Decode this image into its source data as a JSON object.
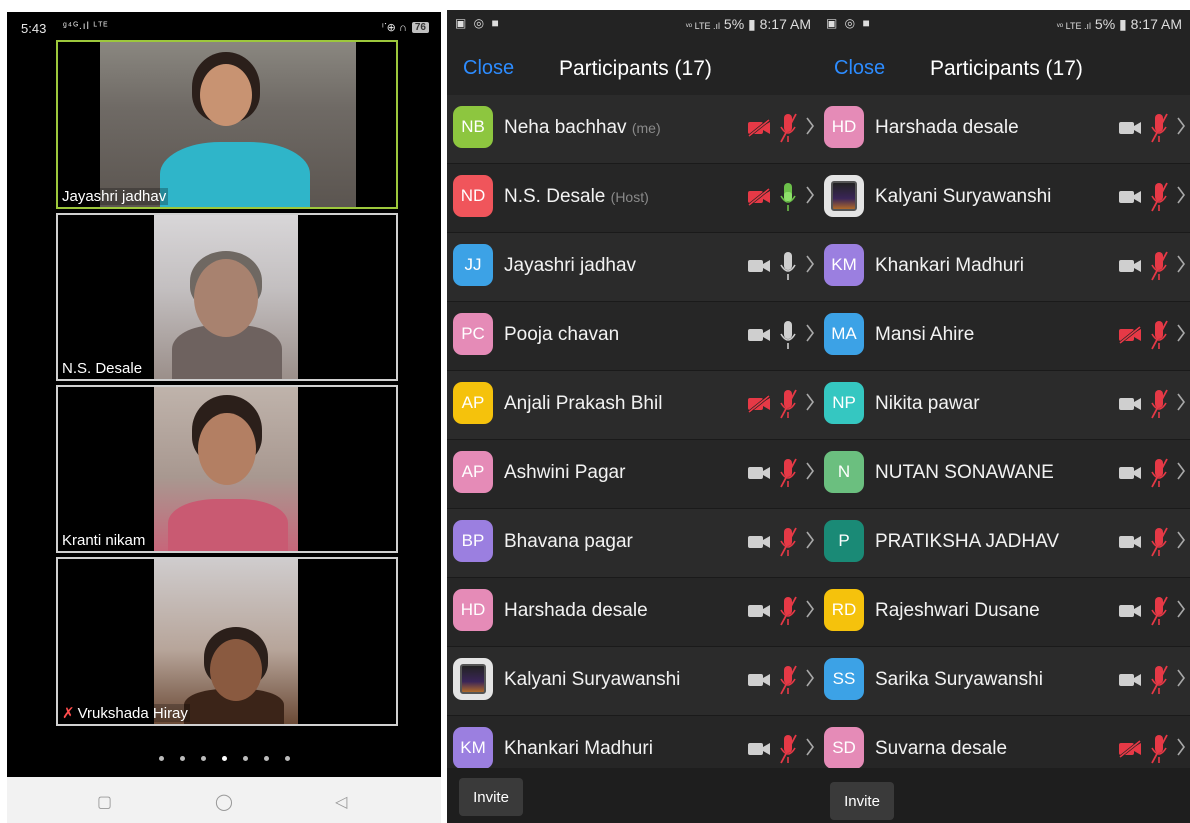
{
  "left_phone": {
    "status": {
      "time": "5:43",
      "signal": "ᵍ⁴ᴳ.ıl ᴸᵀᴱ",
      "icons": "ⁱᐝ⊕ ∩",
      "battery": "76"
    },
    "tiles": [
      {
        "name": "Jayashri jadhav",
        "muted": false
      },
      {
        "name": "N.S. Desale",
        "muted": false
      },
      {
        "name": "Kranti nikam",
        "muted": false
      },
      {
        "name": "Vrukshada Hiray",
        "muted": true
      }
    ],
    "page_dots": 7,
    "active_dot": 3,
    "nav": {
      "recents": "▢",
      "home": "◯",
      "back": "◁"
    }
  },
  "panel_left": {
    "status": {
      "left_icons": "▣ ◎ ■",
      "right": "5% ▮ 8:17 AM",
      "signal": "ᵛᵒ LTE .ıl"
    },
    "close_label": "Close",
    "title": "Participants (17)",
    "invite_label": "Invite",
    "participants": [
      {
        "initials": "NB",
        "name": "Neha bachhav",
        "tag": "(me)",
        "color": "#8dc63f",
        "video_off": true,
        "mic": "muted"
      },
      {
        "initials": "ND",
        "name": "N.S. Desale",
        "tag": "(Host)",
        "color": "#f0555b",
        "video_off": true,
        "mic": "active"
      },
      {
        "initials": "JJ",
        "name": "Jayashri jadhav",
        "tag": "",
        "color": "#3ca2e6",
        "video_off": false,
        "mic": "on"
      },
      {
        "initials": "PC",
        "name": "Pooja chavan",
        "tag": "",
        "color": "#e58bb7",
        "video_off": false,
        "mic": "on"
      },
      {
        "initials": "AP",
        "name": "Anjali Prakash Bhil",
        "tag": "",
        "color": "#f5c20c",
        "video_off": true,
        "mic": "muted"
      },
      {
        "initials": "AP",
        "name": "Ashwini Pagar",
        "tag": "",
        "color": "#e58bb7",
        "video_off": false,
        "mic": "muted"
      },
      {
        "initials": "BP",
        "name": "Bhavana pagar",
        "tag": "",
        "color": "#9b7fe0",
        "video_off": false,
        "mic": "muted"
      },
      {
        "initials": "HD",
        "name": "Harshada desale",
        "tag": "",
        "color": "#e58bb7",
        "video_off": false,
        "mic": "muted"
      },
      {
        "initials": "",
        "name": "Kalyani Suryawanshi",
        "tag": "",
        "color": "mug",
        "video_off": false,
        "mic": "muted"
      },
      {
        "initials": "KM",
        "name": "Khankari Madhuri",
        "tag": "",
        "color": "#9b7fe0",
        "video_off": false,
        "mic": "muted"
      }
    ]
  },
  "panel_right": {
    "status": {
      "left_icons": "▣ ◎ ■",
      "right": "5% ▮ 8:17 AM",
      "signal": "ᵛᵒ LTE .ıl"
    },
    "close_label": "Close",
    "title": "Participants (17)",
    "invite_label": "Invite",
    "participants": [
      {
        "initials": "HD",
        "name": "Harshada desale",
        "tag": "",
        "color": "#e58bb7",
        "video_off": false,
        "mic": "muted"
      },
      {
        "initials": "",
        "name": "Kalyani Suryawanshi",
        "tag": "",
        "color": "mug",
        "video_off": false,
        "mic": "muted"
      },
      {
        "initials": "KM",
        "name": "Khankari Madhuri",
        "tag": "",
        "color": "#9b7fe0",
        "video_off": false,
        "mic": "muted"
      },
      {
        "initials": "MA",
        "name": "Mansi Ahire",
        "tag": "",
        "color": "#3ca2e6",
        "video_off": true,
        "mic": "muted"
      },
      {
        "initials": "NP",
        "name": "Nikita pawar",
        "tag": "",
        "color": "#35c7c1",
        "video_off": false,
        "mic": "muted"
      },
      {
        "initials": "N",
        "name": "NUTAN  SONAWANE",
        "tag": "",
        "color": "#6bbf7f",
        "video_off": false,
        "mic": "muted"
      },
      {
        "initials": "P",
        "name": "PRATIKSHA JADHAV",
        "tag": "",
        "color": "#1a8a76",
        "video_off": false,
        "mic": "muted"
      },
      {
        "initials": "RD",
        "name": "Rajeshwari Dusane",
        "tag": "",
        "color": "#f5c20c",
        "video_off": false,
        "mic": "muted"
      },
      {
        "initials": "SS",
        "name": "Sarika Suryawanshi",
        "tag": "",
        "color": "#3ca2e6",
        "video_off": false,
        "mic": "muted"
      },
      {
        "initials": "SD",
        "name": "Suvarna desale",
        "tag": "",
        "color": "#e58bb7",
        "video_off": true,
        "mic": "muted"
      }
    ]
  }
}
